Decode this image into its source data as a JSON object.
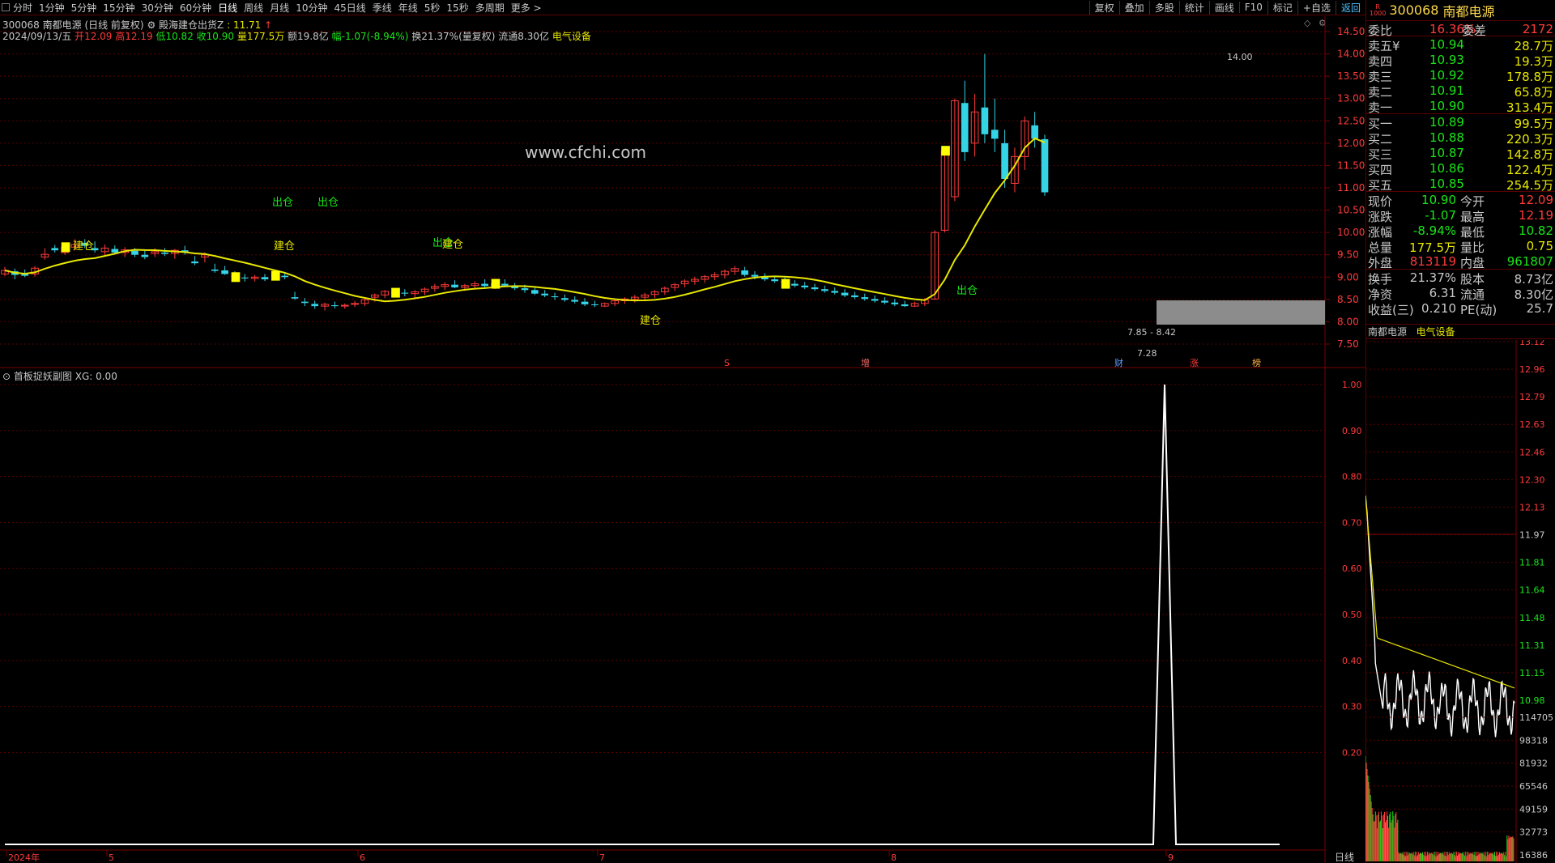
{
  "toolbar": {
    "periods": [
      "分时",
      "1分钟",
      "5分钟",
      "15分钟",
      "30分钟",
      "60分钟",
      "日线",
      "周线",
      "月线",
      "10分钟",
      "45日线",
      "季线",
      "年线",
      "5秒",
      "15秒",
      "多周期",
      "更多 >"
    ],
    "selected": "日线",
    "right_buttons": [
      "复权",
      "叠加",
      "多股",
      "统计",
      "画线",
      "F10",
      "标记",
      "+自选",
      "返回"
    ],
    "active_button": "返回"
  },
  "info": {
    "title": "300068 南都电源 (日线 前复权)",
    "indicator_name": "殿海建仓出货Z",
    "indicator_value": ": 11.71",
    "indicator_arrow": "↑",
    "date": "2024/09/13/五",
    "open_label": "开",
    "open": "12.09",
    "high_label": "高",
    "high": "12.19",
    "low_label": "低",
    "low": "10.82",
    "close_label": "收",
    "close": "10.90",
    "volume": "量177.5万",
    "amount": "额19.8亿",
    "change": "幅-1.07(-8.94%)",
    "turnover": "换21.37%(量复权)",
    "float_cap": "流通8.30亿",
    "sector": "电气设备"
  },
  "main_chart": {
    "y_ticks": [
      14.5,
      14.0,
      13.5,
      13.0,
      12.5,
      12.0,
      11.5,
      11.0,
      10.5,
      10.0,
      9.5,
      9.0,
      8.5,
      8.0,
      7.5
    ],
    "watermark": "www.cfchi.com",
    "high_marker": "14.00",
    "low_marker": "7.28",
    "zone_label": "7.85 - 8.42",
    "signals": [
      {
        "text": "建仓",
        "color": "#e8e800"
      },
      {
        "text": "出仓",
        "color": "#19e619"
      },
      {
        "text": "建仓",
        "color": "#e8e800"
      },
      {
        "text": "出仓",
        "color": "#19e619"
      },
      {
        "text": "出仓",
        "color": "#19e619"
      },
      {
        "text": "建仓",
        "color": "#e8e800"
      },
      {
        "text": "建仓",
        "color": "#e8e800"
      },
      {
        "text": "出仓",
        "color": "#19e619"
      }
    ],
    "event_tags": [
      "S",
      "增",
      "财",
      "涨",
      "榜"
    ],
    "x_labels": [
      "2024年",
      "5",
      "6",
      "7",
      "8",
      "9"
    ],
    "colors": {
      "up": "#ff3b3b",
      "down": "#35d3e6",
      "ma": "#e8e800",
      "signal": "#ffff00",
      "zone": "#8c8c8c"
    }
  },
  "sub_chart": {
    "title": "首板捉妖副图",
    "value_label": "XG: 0.00",
    "y_ticks": [
      "1.00",
      "0.90",
      "0.80",
      "0.70",
      "0.60",
      "0.50",
      "0.40",
      "0.30",
      "0.20"
    ]
  },
  "period_label": "日线",
  "quote": {
    "code": "300068",
    "name": "南都电源",
    "badge_top": "R",
    "badge_bottom": "1000",
    "ratio_label": "委比",
    "ratio_value": "16.36%",
    "diff_label": "委差",
    "diff_value": "2172",
    "sells": [
      {
        "label": "卖五",
        "price": "10.94",
        "vol": "28.7万"
      },
      {
        "label": "卖四",
        "price": "10.93",
        "vol": "19.3万"
      },
      {
        "label": "卖三",
        "price": "10.92",
        "vol": "178.8万"
      },
      {
        "label": "卖二",
        "price": "10.91",
        "vol": "65.8万"
      },
      {
        "label": "卖一",
        "price": "10.90",
        "vol": "313.4万"
      }
    ],
    "sell5_mark": "¥",
    "buys": [
      {
        "label": "买一",
        "price": "10.89",
        "vol": "99.5万"
      },
      {
        "label": "买二",
        "price": "10.88",
        "vol": "220.3万"
      },
      {
        "label": "买三",
        "price": "10.87",
        "vol": "142.8万"
      },
      {
        "label": "买四",
        "price": "10.86",
        "vol": "122.4万"
      },
      {
        "label": "买五",
        "price": "10.85",
        "vol": "254.5万"
      }
    ],
    "stats": [
      {
        "l1": "现价",
        "v1": "10.90",
        "c1": "#19e619",
        "l2": "今开",
        "v2": "12.09",
        "c2": "#ff3b3b"
      },
      {
        "l1": "涨跌",
        "v1": "-1.07",
        "c1": "#19e619",
        "l2": "最高",
        "v2": "12.19",
        "c2": "#ff3b3b"
      },
      {
        "l1": "涨幅",
        "v1": "-8.94%",
        "c1": "#19e619",
        "l2": "最低",
        "v2": "10.82",
        "c2": "#19e619"
      },
      {
        "l1": "总量",
        "v1": "177.5万",
        "c1": "#e8e800",
        "l2": "量比",
        "v2": "0.75",
        "c2": "#e8e800"
      },
      {
        "l1": "外盘",
        "v1": "813119",
        "c1": "#ff3b3b",
        "l2": "内盘",
        "v2": "961807",
        "c2": "#19e619"
      }
    ],
    "stats2": [
      {
        "l1": "换手",
        "v1": "21.37%",
        "l2": "股本",
        "v2": "8.73亿"
      },
      {
        "l1": "净资",
        "v1": "6.31",
        "l2": "流通",
        "v2": "8.30亿"
      },
      {
        "l1": "收益(三)",
        "v1": "0.210",
        "l2": "PE(动)",
        "v2": "25.7"
      }
    ]
  },
  "intraday": {
    "name": "南都电源",
    "sector": "电气设备",
    "price_ticks": [
      "13.12",
      "12.96",
      "12.79",
      "12.63",
      "12.46",
      "12.30",
      "12.13",
      "11.97",
      "11.81",
      "11.64",
      "11.48",
      "11.31",
      "11.15",
      "10.98"
    ],
    "vol_ticks": [
      "114705",
      "98318",
      "81932",
      "65546",
      "49159",
      "32773",
      "16386"
    ]
  }
}
